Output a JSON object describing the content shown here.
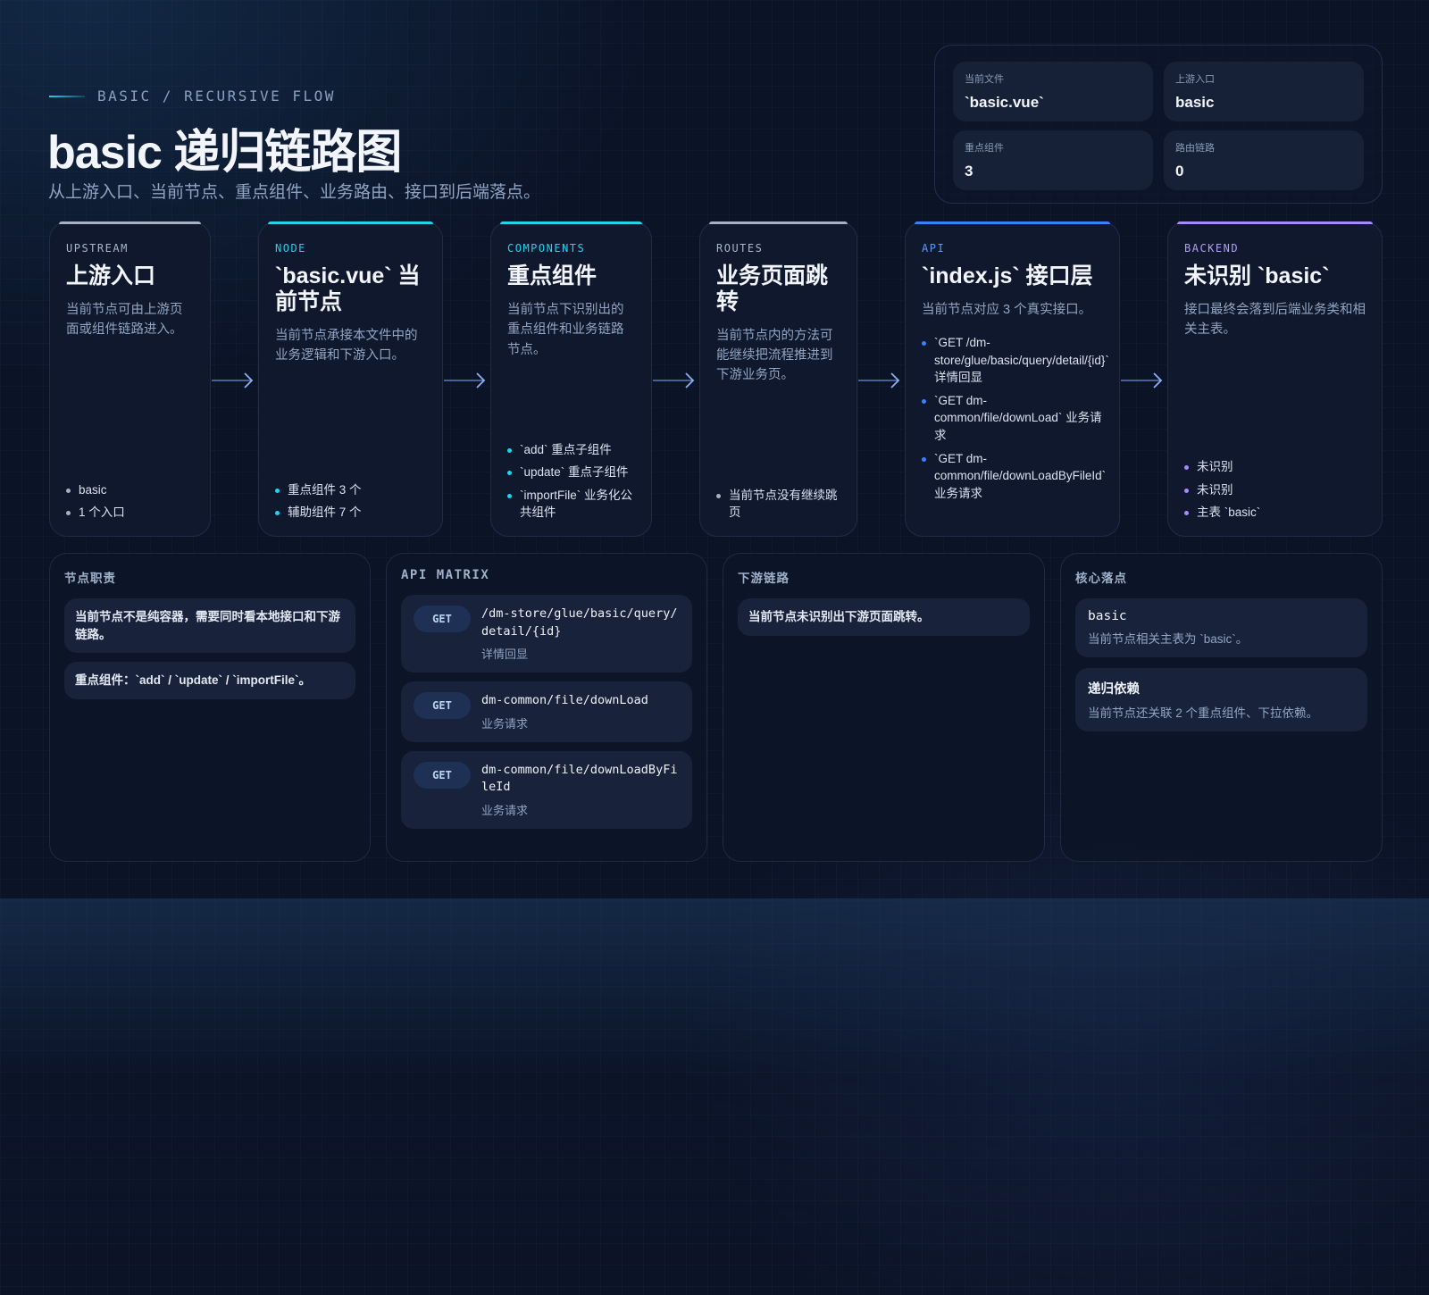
{
  "header": {
    "eyebrow": "BASIC / RECURSIVE FLOW",
    "title": "basic 递归链路图",
    "subtitle": "从上游入口、当前节点、重点组件、业务路由、接口到后端落点。"
  },
  "stats": [
    {
      "label": "当前文件",
      "value": "`basic.vue`"
    },
    {
      "label": "上游入口",
      "value": "basic"
    },
    {
      "label": "重点组件",
      "value": "3"
    },
    {
      "label": "路由链路",
      "value": "0"
    }
  ],
  "flow": [
    {
      "tag": "UPSTREAM",
      "title": "上游入口",
      "desc": "当前节点可由上游页面或组件链路进入。",
      "bullets": [
        "basic",
        "1 个入口"
      ],
      "accent": "#a7b1c2",
      "dot": "#a7b1c2",
      "tag_color": "#a9b6c9"
    },
    {
      "tag": "NODE",
      "title": "`basic.vue` 当前节点",
      "desc": "当前节点承接本文件中的业务逻辑和下游入口。",
      "bullets": [
        "重点组件 3 个",
        "辅助组件 7 个"
      ],
      "accent": "#22d3ee",
      "dot": "#22d3ee",
      "tag_color": "#22d3ee"
    },
    {
      "tag": "COMPONENTS",
      "title": "重点组件",
      "desc": "当前节点下识别出的重点组件和业务链路节点。",
      "bullets": [
        "`add` 重点子组件",
        "`update` 重点子组件",
        "`importFile` 业务化公共组件"
      ],
      "accent": "#22d3ee",
      "dot": "#22d3ee",
      "tag_color": "#22d3ee"
    },
    {
      "tag": "ROUTES",
      "title": "业务页面跳转",
      "desc": "当前节点内的方法可能继续把流程推进到下游业务页。",
      "bullets": [
        "当前节点没有继续跳页"
      ],
      "accent": "#a7b1c2",
      "dot": "#a7b1c2",
      "tag_color": "#a9b6c9"
    },
    {
      "tag": "API",
      "title": "`index.js` 接口层",
      "desc": "当前节点对应 3 个真实接口。",
      "bullets": [
        "`GET /dm-store/glue/basic/query/detail/{id}` 详情回显",
        "`GET dm-common/file/downLoad` 业务请求",
        "`GET dm-common/file/downLoadByFileId` 业务请求"
      ],
      "accent": "#3b82f6",
      "dot": "#3b82f6",
      "tag_color": "#5b9bf8"
    },
    {
      "tag": "BACKEND",
      "title": "未识别 `basic`",
      "desc": "接口最终会落到后端业务类和相关主表。",
      "bullets": [
        "未识别",
        "未识别",
        "主表 `basic`"
      ],
      "accent": "#a78bfa",
      "dot": "#a78bfa",
      "tag_color": "#b39dfb"
    }
  ],
  "panels": {
    "duties": {
      "title": "节点职责",
      "notes": [
        "当前节点不是纯容器，需要同时看本地接口和下游链路。",
        "重点组件：`add` / `update` / `importFile`。"
      ]
    },
    "api_matrix": {
      "title": "API MATRIX",
      "items": [
        {
          "method": "GET",
          "path": "/dm-store/glue/basic/query/detail/{id}",
          "desc": "详情回显"
        },
        {
          "method": "GET",
          "path": "dm-common/file/downLoad",
          "desc": "业务请求"
        },
        {
          "method": "GET",
          "path": "dm-common/file/downLoadByFileId",
          "desc": "业务请求"
        }
      ]
    },
    "downstream": {
      "title": "下游链路",
      "notes": [
        "当前节点未识别出下游页面跳转。"
      ]
    },
    "core": {
      "title": "核心落点",
      "items": [
        {
          "key": "basic",
          "value": "当前节点相关主表为 `basic`。"
        },
        {
          "key": "递归依赖",
          "value": "当前节点还关联 2 个重点组件、下拉依赖。"
        }
      ]
    }
  },
  "colors": {
    "accent_cyan": "#22d3ee",
    "accent_blue": "#3b82f6",
    "accent_violet": "#a78bfa",
    "background": "#0b1327"
  }
}
